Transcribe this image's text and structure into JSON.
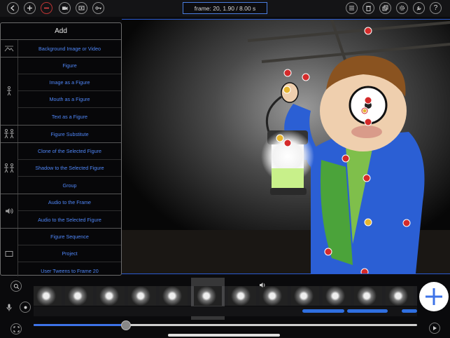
{
  "toolbar": {
    "left_buttons": [
      "add",
      "remove",
      "camera",
      "photo",
      "key"
    ],
    "frame_readout": "frame: 20, 1.90 / 8.00 s",
    "right_buttons": [
      "list",
      "trash",
      "copy",
      "settings",
      "wrench",
      "help"
    ],
    "help_label": "?"
  },
  "panel": {
    "title": "Add",
    "groups": [
      {
        "icon": "landscape-icon",
        "items": [
          "Background Image or Video"
        ]
      },
      {
        "icon": "figure-icon",
        "items": [
          "Figure",
          "Image as a Figure",
          "Mouth as a Figure",
          "Text as a Figure"
        ]
      },
      {
        "icon": "substitute-icon",
        "items": [
          "Figure Substitute"
        ]
      },
      {
        "icon": "clone-icon",
        "items": [
          "Clone of the Selected Figure",
          "Shadow to the Selected Figure",
          "Group"
        ]
      },
      {
        "icon": "speaker-icon",
        "items": [
          "Audio to the Frame",
          "Audio to the Selected Figure"
        ]
      },
      {
        "icon": "sequence-icon",
        "items": [
          "Figure Sequence",
          "Project",
          "User Tweens to Frame 20"
        ]
      }
    ]
  },
  "timeline": {
    "audio_icon": "speaker-icon",
    "frame_count": 12,
    "selected_frame": 6,
    "playhead_fraction": 0.24
  },
  "colors": {
    "accent": "#4f86f7",
    "panel_bg": "#070709",
    "remove_red": "#e44444"
  }
}
